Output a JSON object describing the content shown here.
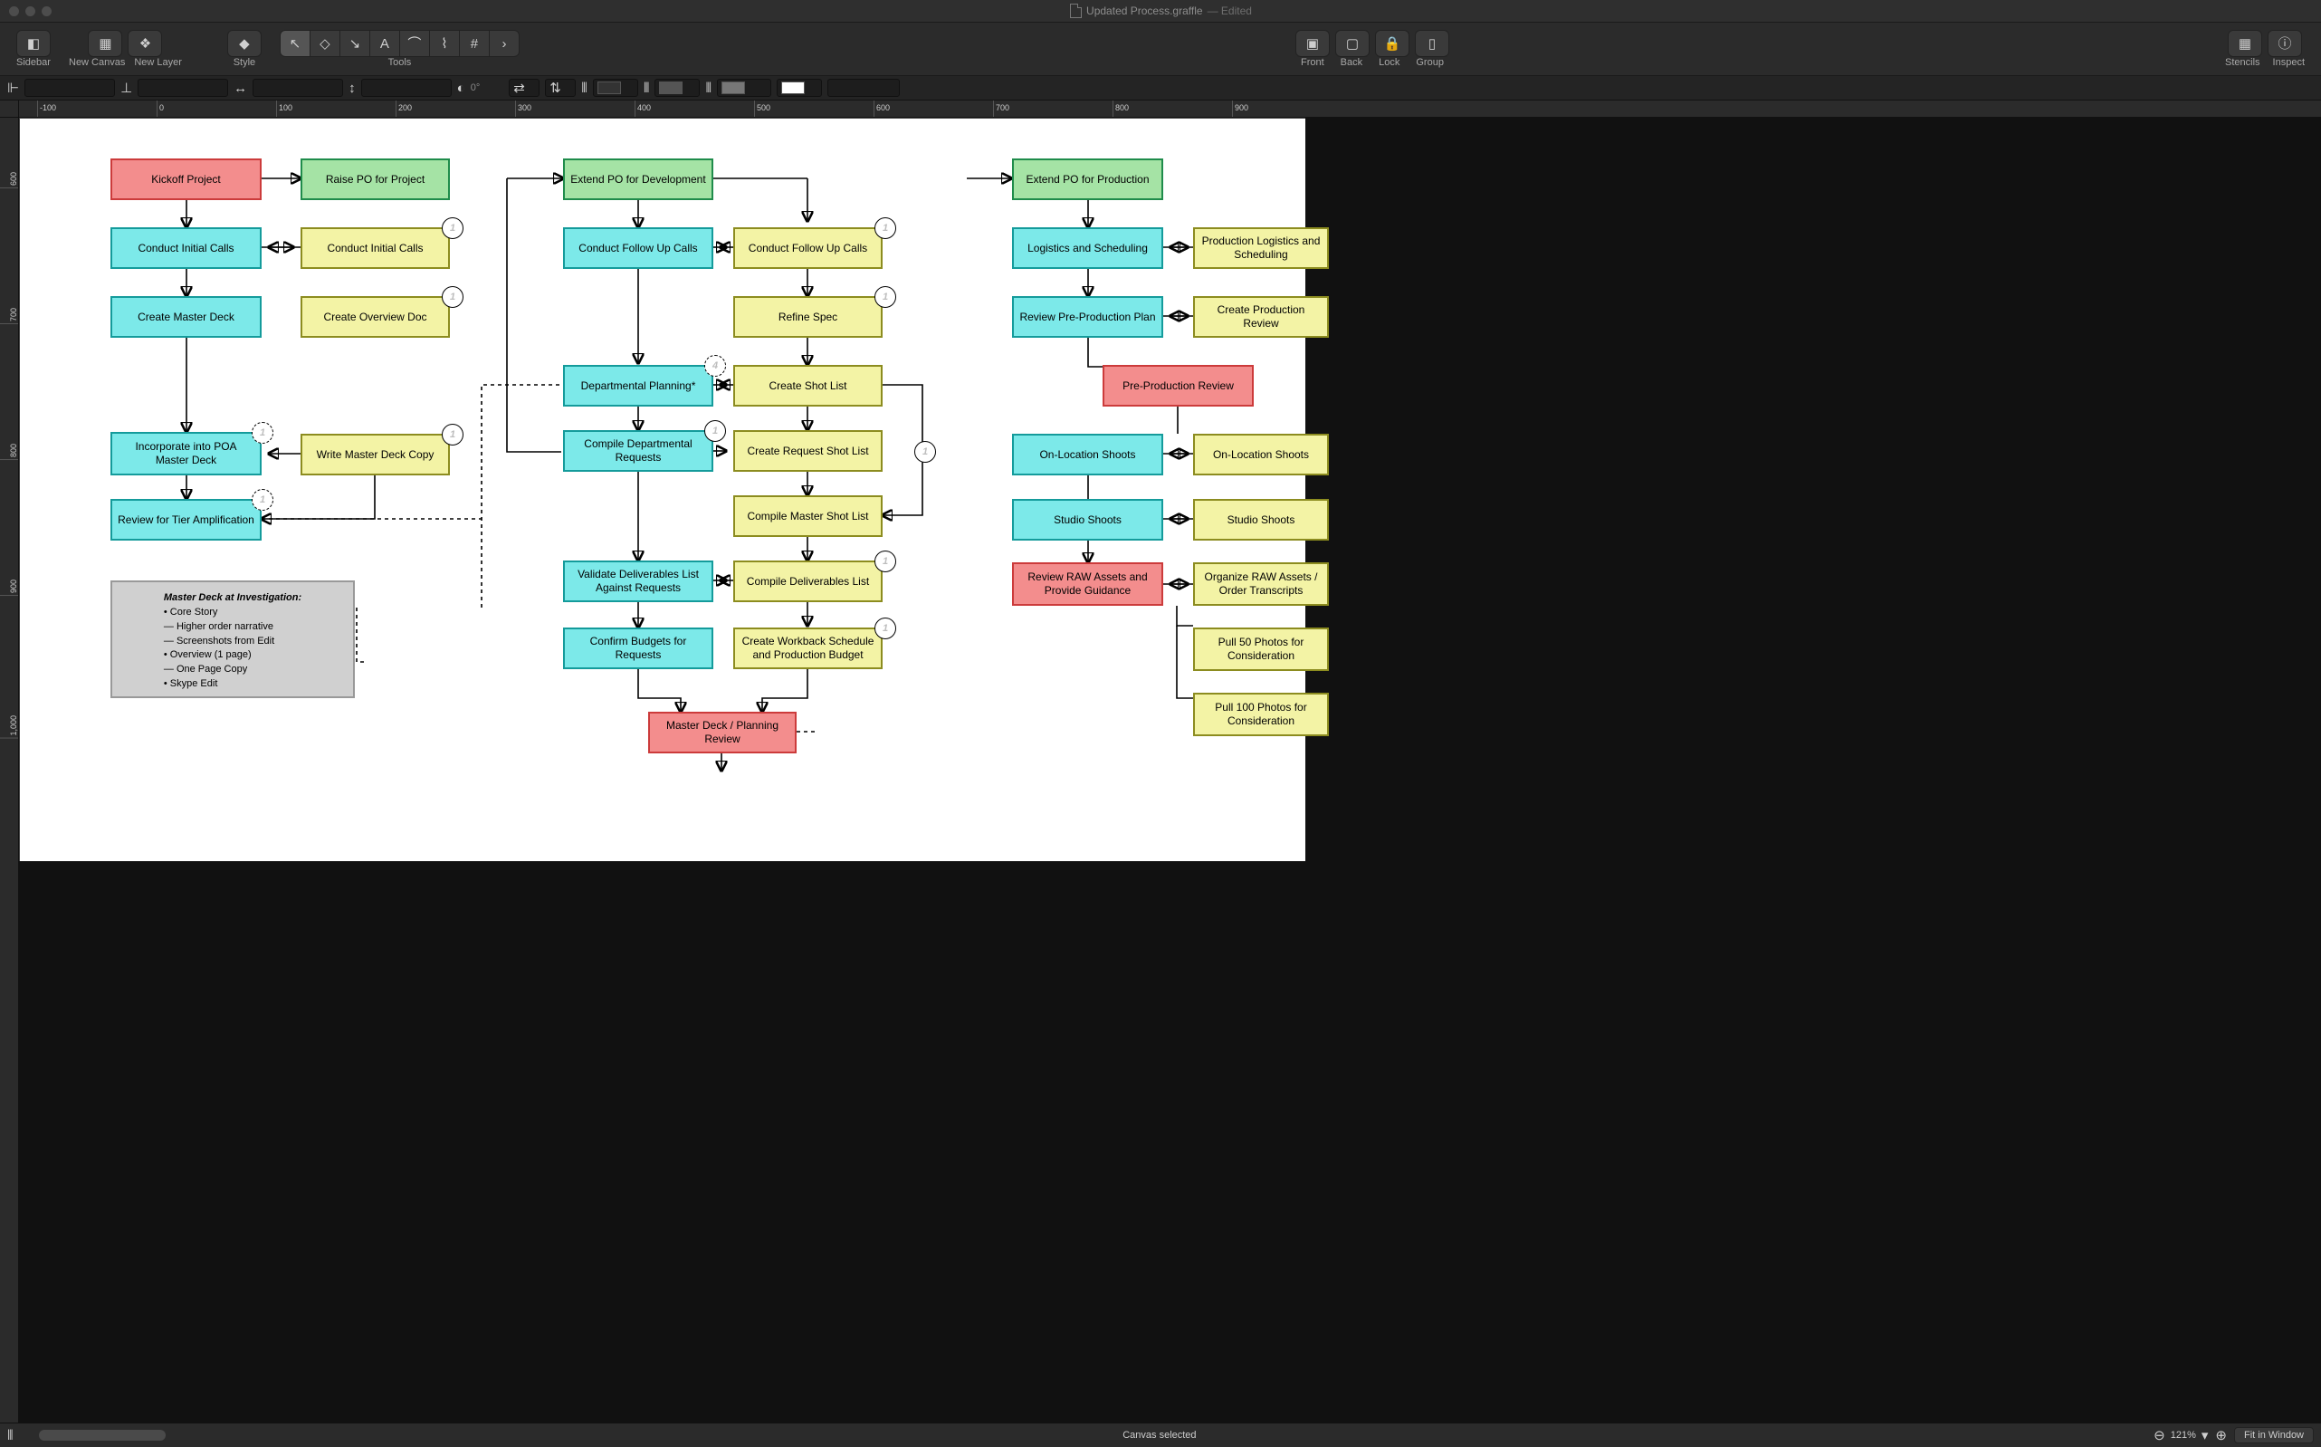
{
  "window": {
    "filename": "Updated Process.graffle",
    "status": "— Edited"
  },
  "toolbar": {
    "sidebar": "Sidebar",
    "new_canvas": "New Canvas",
    "new_layer": "New Layer",
    "style": "Style",
    "tools": "Tools",
    "front": "Front",
    "back": "Back",
    "lock": "Lock",
    "group": "Group",
    "stencils": "Stencils",
    "inspect": "Inspect"
  },
  "formatbar": {
    "rotation": "0°"
  },
  "ruler_h": [
    "-100",
    "0",
    "100",
    "200",
    "300",
    "400",
    "500",
    "600",
    "700",
    "800",
    "900"
  ],
  "ruler_v": [
    "600",
    "700",
    "800",
    "900",
    "1,000"
  ],
  "status": {
    "message": "Canvas selected",
    "zoom": "121%",
    "fit": "Fit in Window"
  },
  "boxes": {
    "kickoff": "Kickoff Project",
    "raise_po": "Raise PO for Project",
    "calls_teal": "Conduct Initial Calls",
    "calls_yellow": "Conduct Initial Calls",
    "master_deck": "Create Master Deck",
    "overview_doc": "Create Overview Doc",
    "incorp_poa": "Incorporate into POA Master Deck",
    "write_copy": "Write Master Deck Copy",
    "review_tier": "Review for Tier Amplification",
    "extend_po_dev": "Extend PO for Development",
    "fu_teal": "Conduct Follow Up Calls",
    "fu_yellow": "Conduct Follow Up Calls",
    "refine_spec": "Refine Spec",
    "dept_plan": "Departmental Planning*",
    "shot_list": "Create Shot List",
    "compile_dept": "Compile Departmental Requests",
    "req_shot_list": "Create Request Shot List",
    "compile_master_shot": "Compile Master Shot List",
    "validate_deliv": "Validate Deliverables List Against Requests",
    "compile_deliv": "Compile Deliverables List",
    "confirm_budgets": "Confirm Budgets for Requests",
    "workback": "Create Workback Schedule and Production Budget",
    "master_review": "Master Deck / Planning Review",
    "extend_po_prod": "Extend PO for Production",
    "logistics_teal": "Logistics and Scheduling",
    "logistics_yellow": "Production Logistics and Scheduling",
    "review_preprod": "Review Pre-Production Plan",
    "create_prod_rev": "Create Production Review",
    "preprod_review": "Pre-Production Review",
    "onloc_teal": "On-Location Shoots",
    "onloc_yellow": "On-Location Shoots",
    "studio_teal": "Studio Shoots",
    "studio_yellow": "Studio Shoots",
    "review_raw": "Review RAW Assets and Provide Guidance",
    "organize_raw": "Organize RAW Assets / Order Transcripts",
    "pull_50": "Pull 50 Photos for Consideration",
    "pull_100": "Pull 100 Photos for Consideration"
  },
  "note": {
    "title": "Master Deck at Investigation:",
    "lines": [
      "• Core Story",
      "— Higher order narrative",
      "— Screenshots from Edit",
      "• Overview (1 page)",
      "— One Page Copy",
      "• Skype Edit"
    ]
  }
}
